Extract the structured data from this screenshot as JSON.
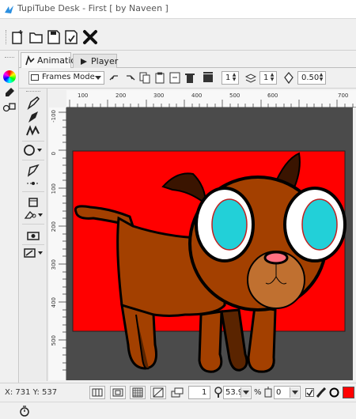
{
  "window": {
    "title": "TupiTube Desk - First [ by Naveen ]"
  },
  "toolbar": {
    "icons": [
      "new-icon",
      "open-icon",
      "save-icon",
      "save-as-icon",
      "close-project-icon"
    ]
  },
  "tabs": [
    {
      "label": "Animation",
      "active": true
    },
    {
      "label": "Player",
      "active": false
    }
  ],
  "framebar": {
    "mode": "Frames Mode",
    "spin1": "1",
    "spin2": "1",
    "opacity": "0.50"
  },
  "rulers": {
    "top": [
      "100",
      "200",
      "300",
      "400",
      "500",
      "600",
      "700"
    ],
    "left": [
      "-100",
      "0",
      "100",
      "200",
      "300",
      "400",
      "500"
    ]
  },
  "bottombar": {
    "coords": "X: 731 Y: 537",
    "frame": "1",
    "zoom": "53.9",
    "zoom_unit": "%",
    "rotation": "0"
  },
  "colors": {
    "canvas_bg": "#ff0000",
    "workspace": "#4b4b4b",
    "dog_body": "#a34000",
    "eye": "#22d0d8",
    "fill_swatch": "#ff0000"
  }
}
